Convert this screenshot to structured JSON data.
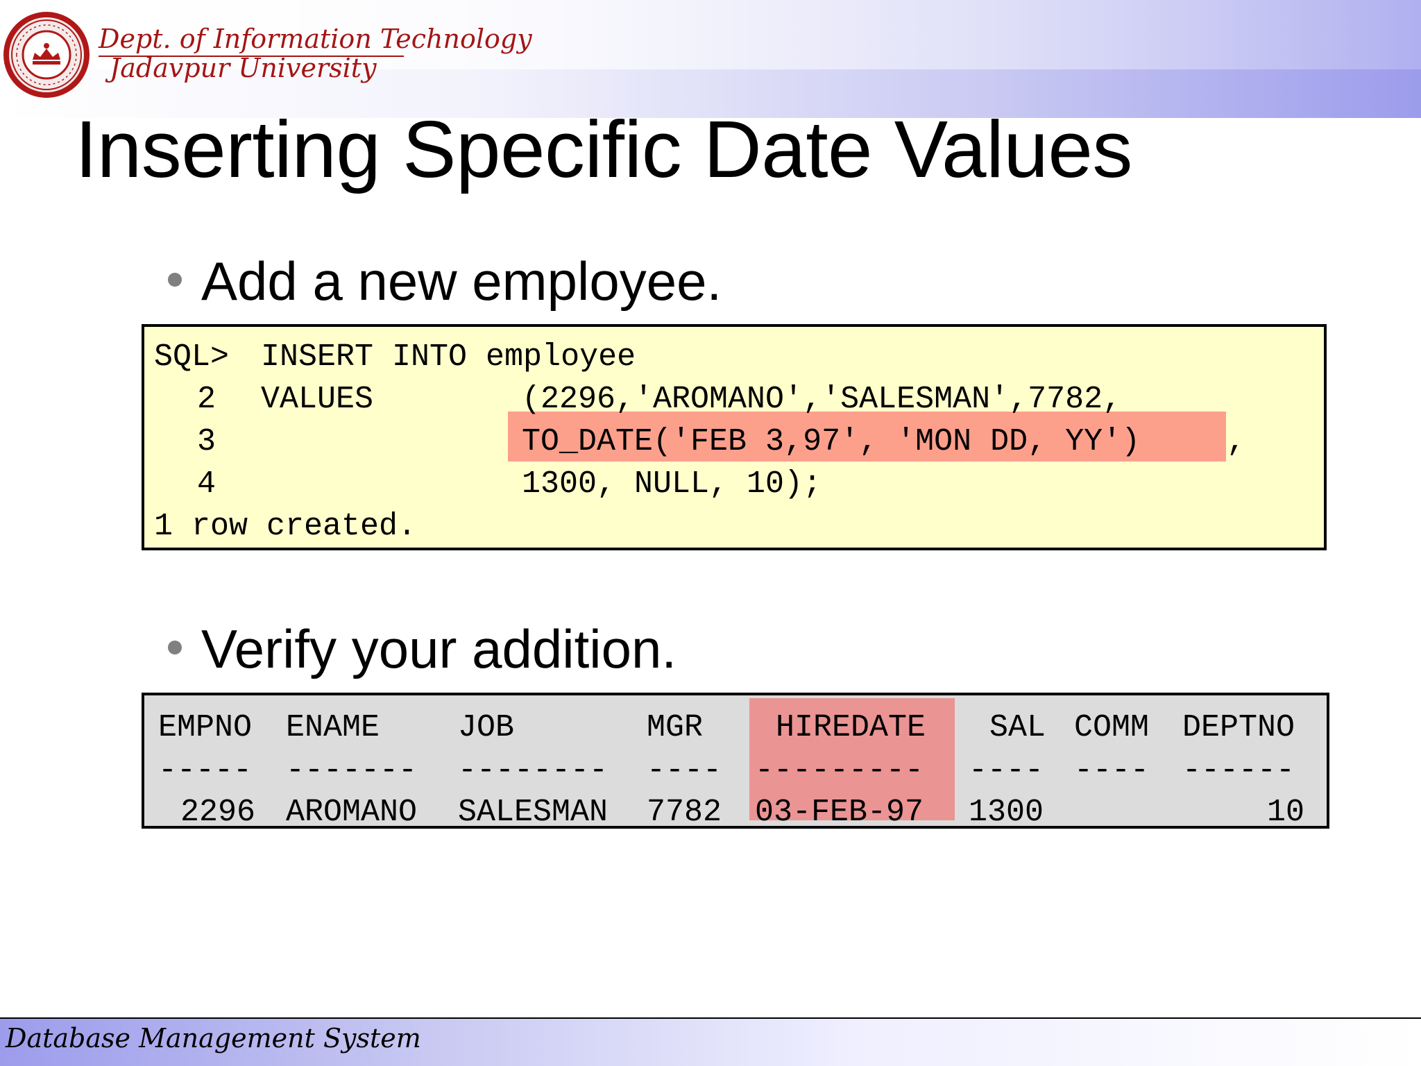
{
  "header": {
    "dept": "Dept. of Information Technology",
    "university": "Jadavpur University"
  },
  "title": "Inserting Specific Date Values",
  "bullets": [
    "Add a new employee.",
    "Verify your addition."
  ],
  "code": {
    "lines": [
      {
        "num": "SQL>",
        "text": "INSERT INTO employee"
      },
      {
        "num": "2",
        "text": "VALUES"
      },
      {
        "num": "3",
        "text": ""
      },
      {
        "num": "4",
        "text": ""
      }
    ],
    "values_part1": "(2296,'AROMANO','SALESMAN',7782,",
    "highlighted": "TO_DATE('FEB 3,97', 'MON DD, YY')",
    "trailing_comma": ",",
    "values_part3": "1300, NULL, 10);",
    "result": "1 row created."
  },
  "result_table": {
    "headers": [
      "EMPNO",
      "ENAME",
      "JOB",
      "MGR",
      "HIREDATE",
      "SAL",
      "COMM",
      "DEPTNO"
    ],
    "dashes": [
      "-----",
      "-------",
      "--------",
      "----",
      "---------",
      "----",
      "----",
      "------"
    ],
    "row": [
      "2296",
      "AROMANO",
      "SALESMAN",
      "7782",
      "03-FEB-97",
      "1300",
      "",
      "10"
    ]
  },
  "footer": "Database Management System",
  "colors": {
    "code_bg": "#ffffcc",
    "result_bg": "#dcdcdc",
    "code_highlight": "#fca08c",
    "result_highlight": "#eb9494",
    "header_text": "#a31515"
  }
}
